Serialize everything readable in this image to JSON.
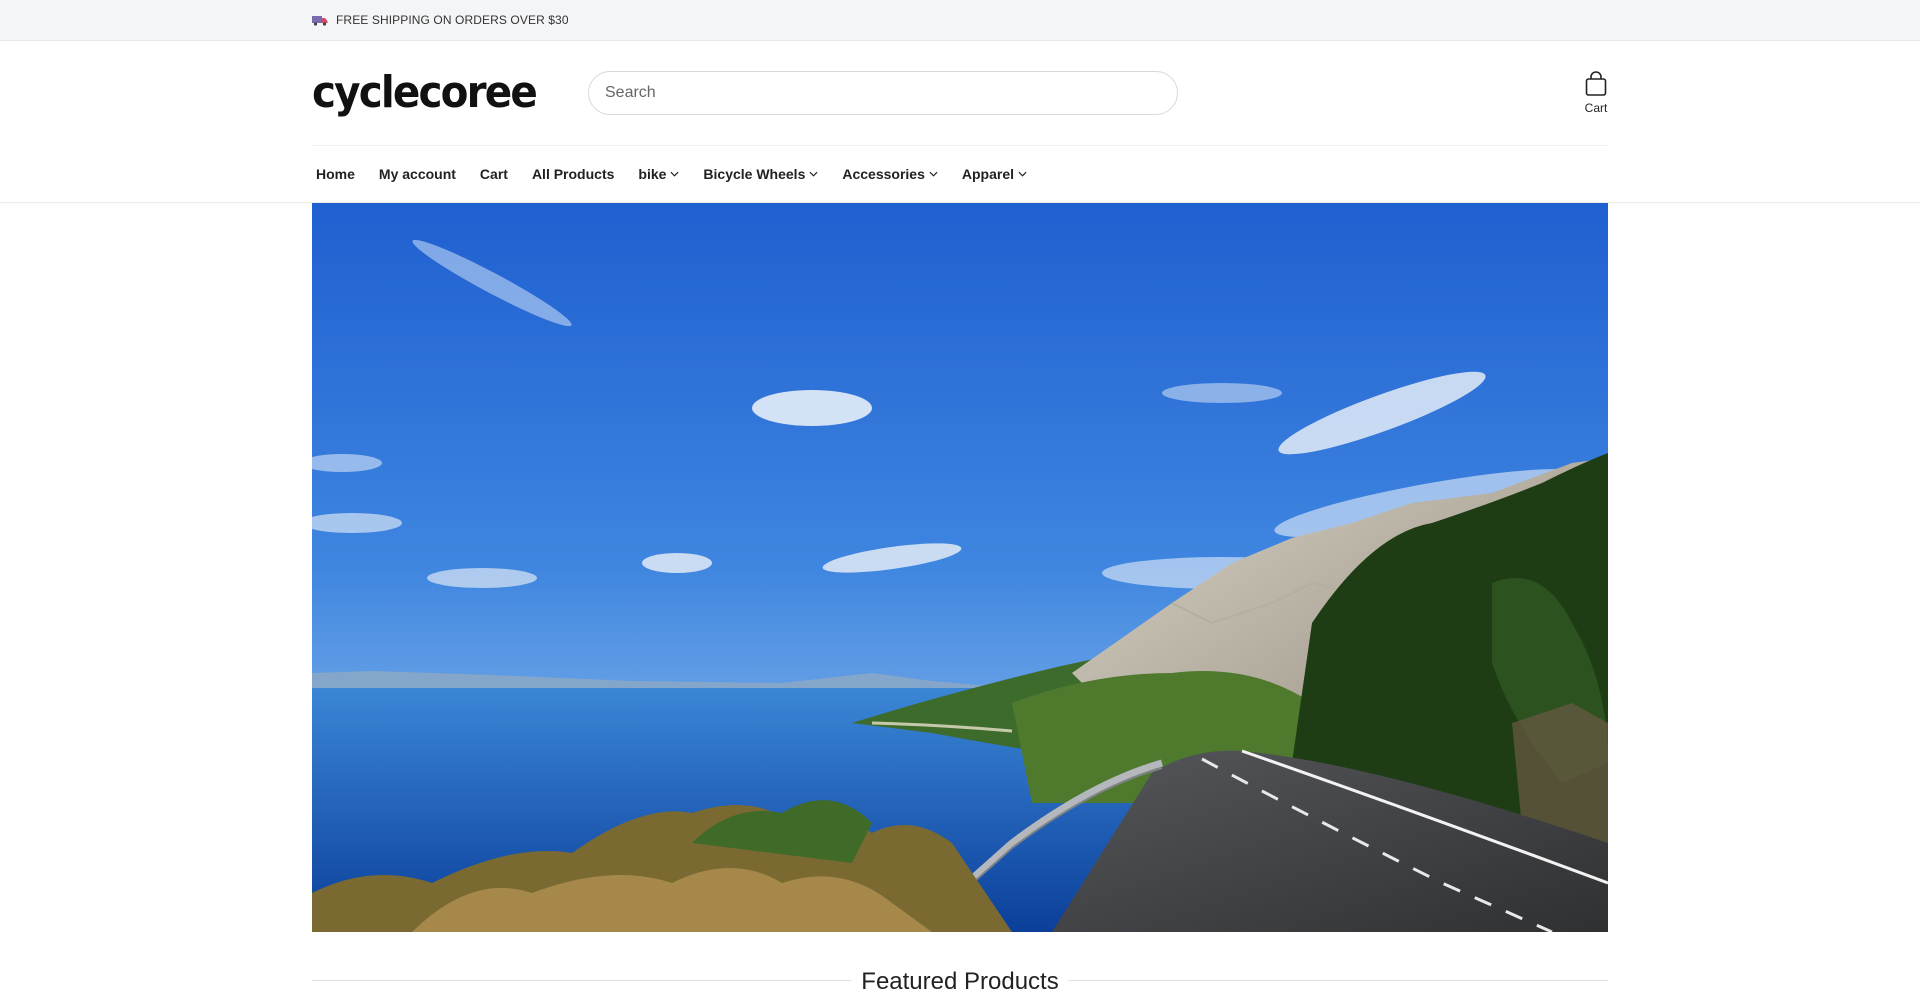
{
  "announcement": {
    "text": "FREE SHIPPING ON ORDERS OVER $30",
    "icon": "truck-icon"
  },
  "header": {
    "logo_text": "cyclecoree",
    "search": {
      "placeholder": "Search",
      "value": ""
    },
    "cart_label": "Cart"
  },
  "nav": {
    "items": [
      {
        "label": "Home",
        "dropdown": false
      },
      {
        "label": "My account",
        "dropdown": false
      },
      {
        "label": "Cart",
        "dropdown": false
      },
      {
        "label": "All Products",
        "dropdown": false
      },
      {
        "label": "bike",
        "dropdown": true
      },
      {
        "label": "Bicycle Wheels",
        "dropdown": true
      },
      {
        "label": "Accessories",
        "dropdown": true
      },
      {
        "label": "Apparel",
        "dropdown": true
      }
    ]
  },
  "featured": {
    "title": "Featured Products"
  },
  "colors": {
    "sky": "#2e73d9",
    "sea": "#1a5fbf",
    "road": "#3a3a3a"
  }
}
